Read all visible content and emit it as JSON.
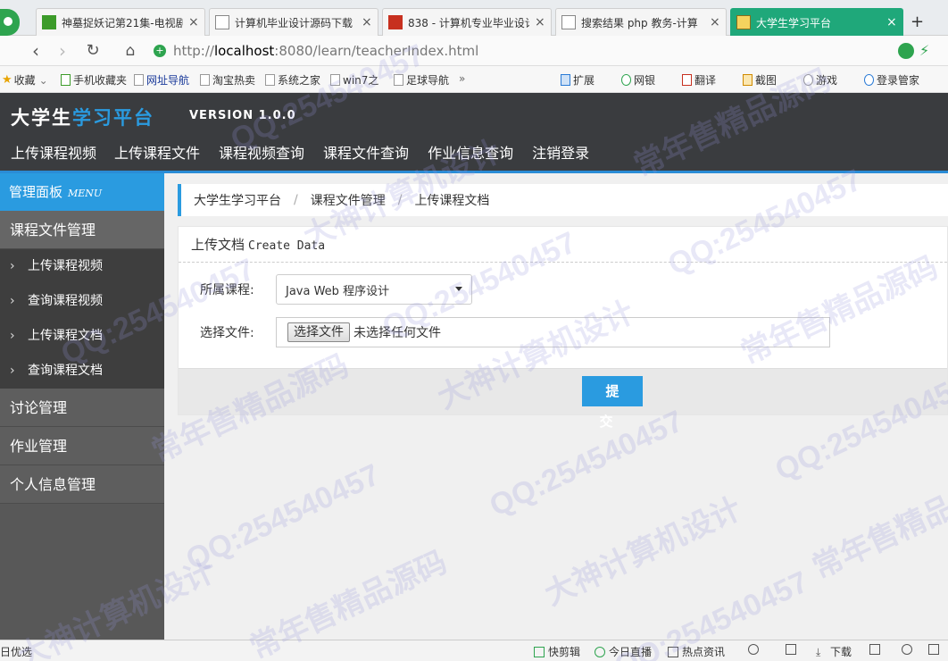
{
  "browser": {
    "tabs": [
      {
        "title": "神墓捉妖记第21集-电视剧",
        "favicon": "iqiyi-icon",
        "active": false
      },
      {
        "title": "计算机毕业设计源码下载",
        "favicon": "document-icon",
        "active": false
      },
      {
        "title": "838 - 计算机专业毕业设计",
        "favicon": "red-site-icon",
        "active": false
      },
      {
        "title": "搜索结果 php 教务-计算",
        "favicon": "document-icon",
        "active": false
      },
      {
        "title": "大学生学习平台",
        "favicon": "app-icon",
        "active": true
      }
    ],
    "tab_close": "×",
    "new_tab": "+",
    "address": {
      "scheme": "http://",
      "host": "localhost",
      "rest": ":8080/learn/teacherIndex.html"
    },
    "bookmarks": [
      "收藏",
      "手机收藏夹",
      "网址导航",
      "淘宝热卖",
      "系统之家",
      "win7之",
      "足球导航"
    ],
    "bookmarks_more": "»",
    "toolbar_right": [
      "扩展",
      "网银",
      "翻译",
      "截图",
      "游戏",
      "登录管家"
    ]
  },
  "app": {
    "brand_part1": "大学生",
    "brand_part2": "学习平台",
    "version": "VERSION 1.0.0",
    "top_nav": [
      "上传课程视频",
      "上传课程文件",
      "课程视频查询",
      "课程文件查询",
      "作业信息查询",
      "注销登录"
    ]
  },
  "sidebar": {
    "panel_title": "管理面板",
    "panel_title_en": "MENU",
    "groups": [
      {
        "label": "课程文件管理",
        "open": true,
        "items": [
          "上传课程视频",
          "查询课程视频",
          "上传课程文档",
          "查询课程文档"
        ]
      },
      {
        "label": "讨论管理"
      },
      {
        "label": "作业管理"
      },
      {
        "label": "个人信息管理"
      }
    ]
  },
  "breadcrumb": [
    "大学生学习平台",
    "课程文件管理",
    "上传课程文档"
  ],
  "breadcrumb_sep": "/",
  "form": {
    "title": "上传文档",
    "title_en": "Create Data",
    "course_label": "所属课程:",
    "course_value": "Java Web 程序设计",
    "file_label": "选择文件:",
    "file_button": "选择文件",
    "file_status": "未选择任何文件",
    "submit_label": "提交"
  },
  "statusbar": {
    "left": "日优选",
    "items": [
      "快剪辑",
      "今日直播",
      "热点资讯",
      "下载"
    ]
  },
  "watermarks": [
    "QQ:254540457",
    "常年售精品源码",
    "大神计算机设计"
  ]
}
